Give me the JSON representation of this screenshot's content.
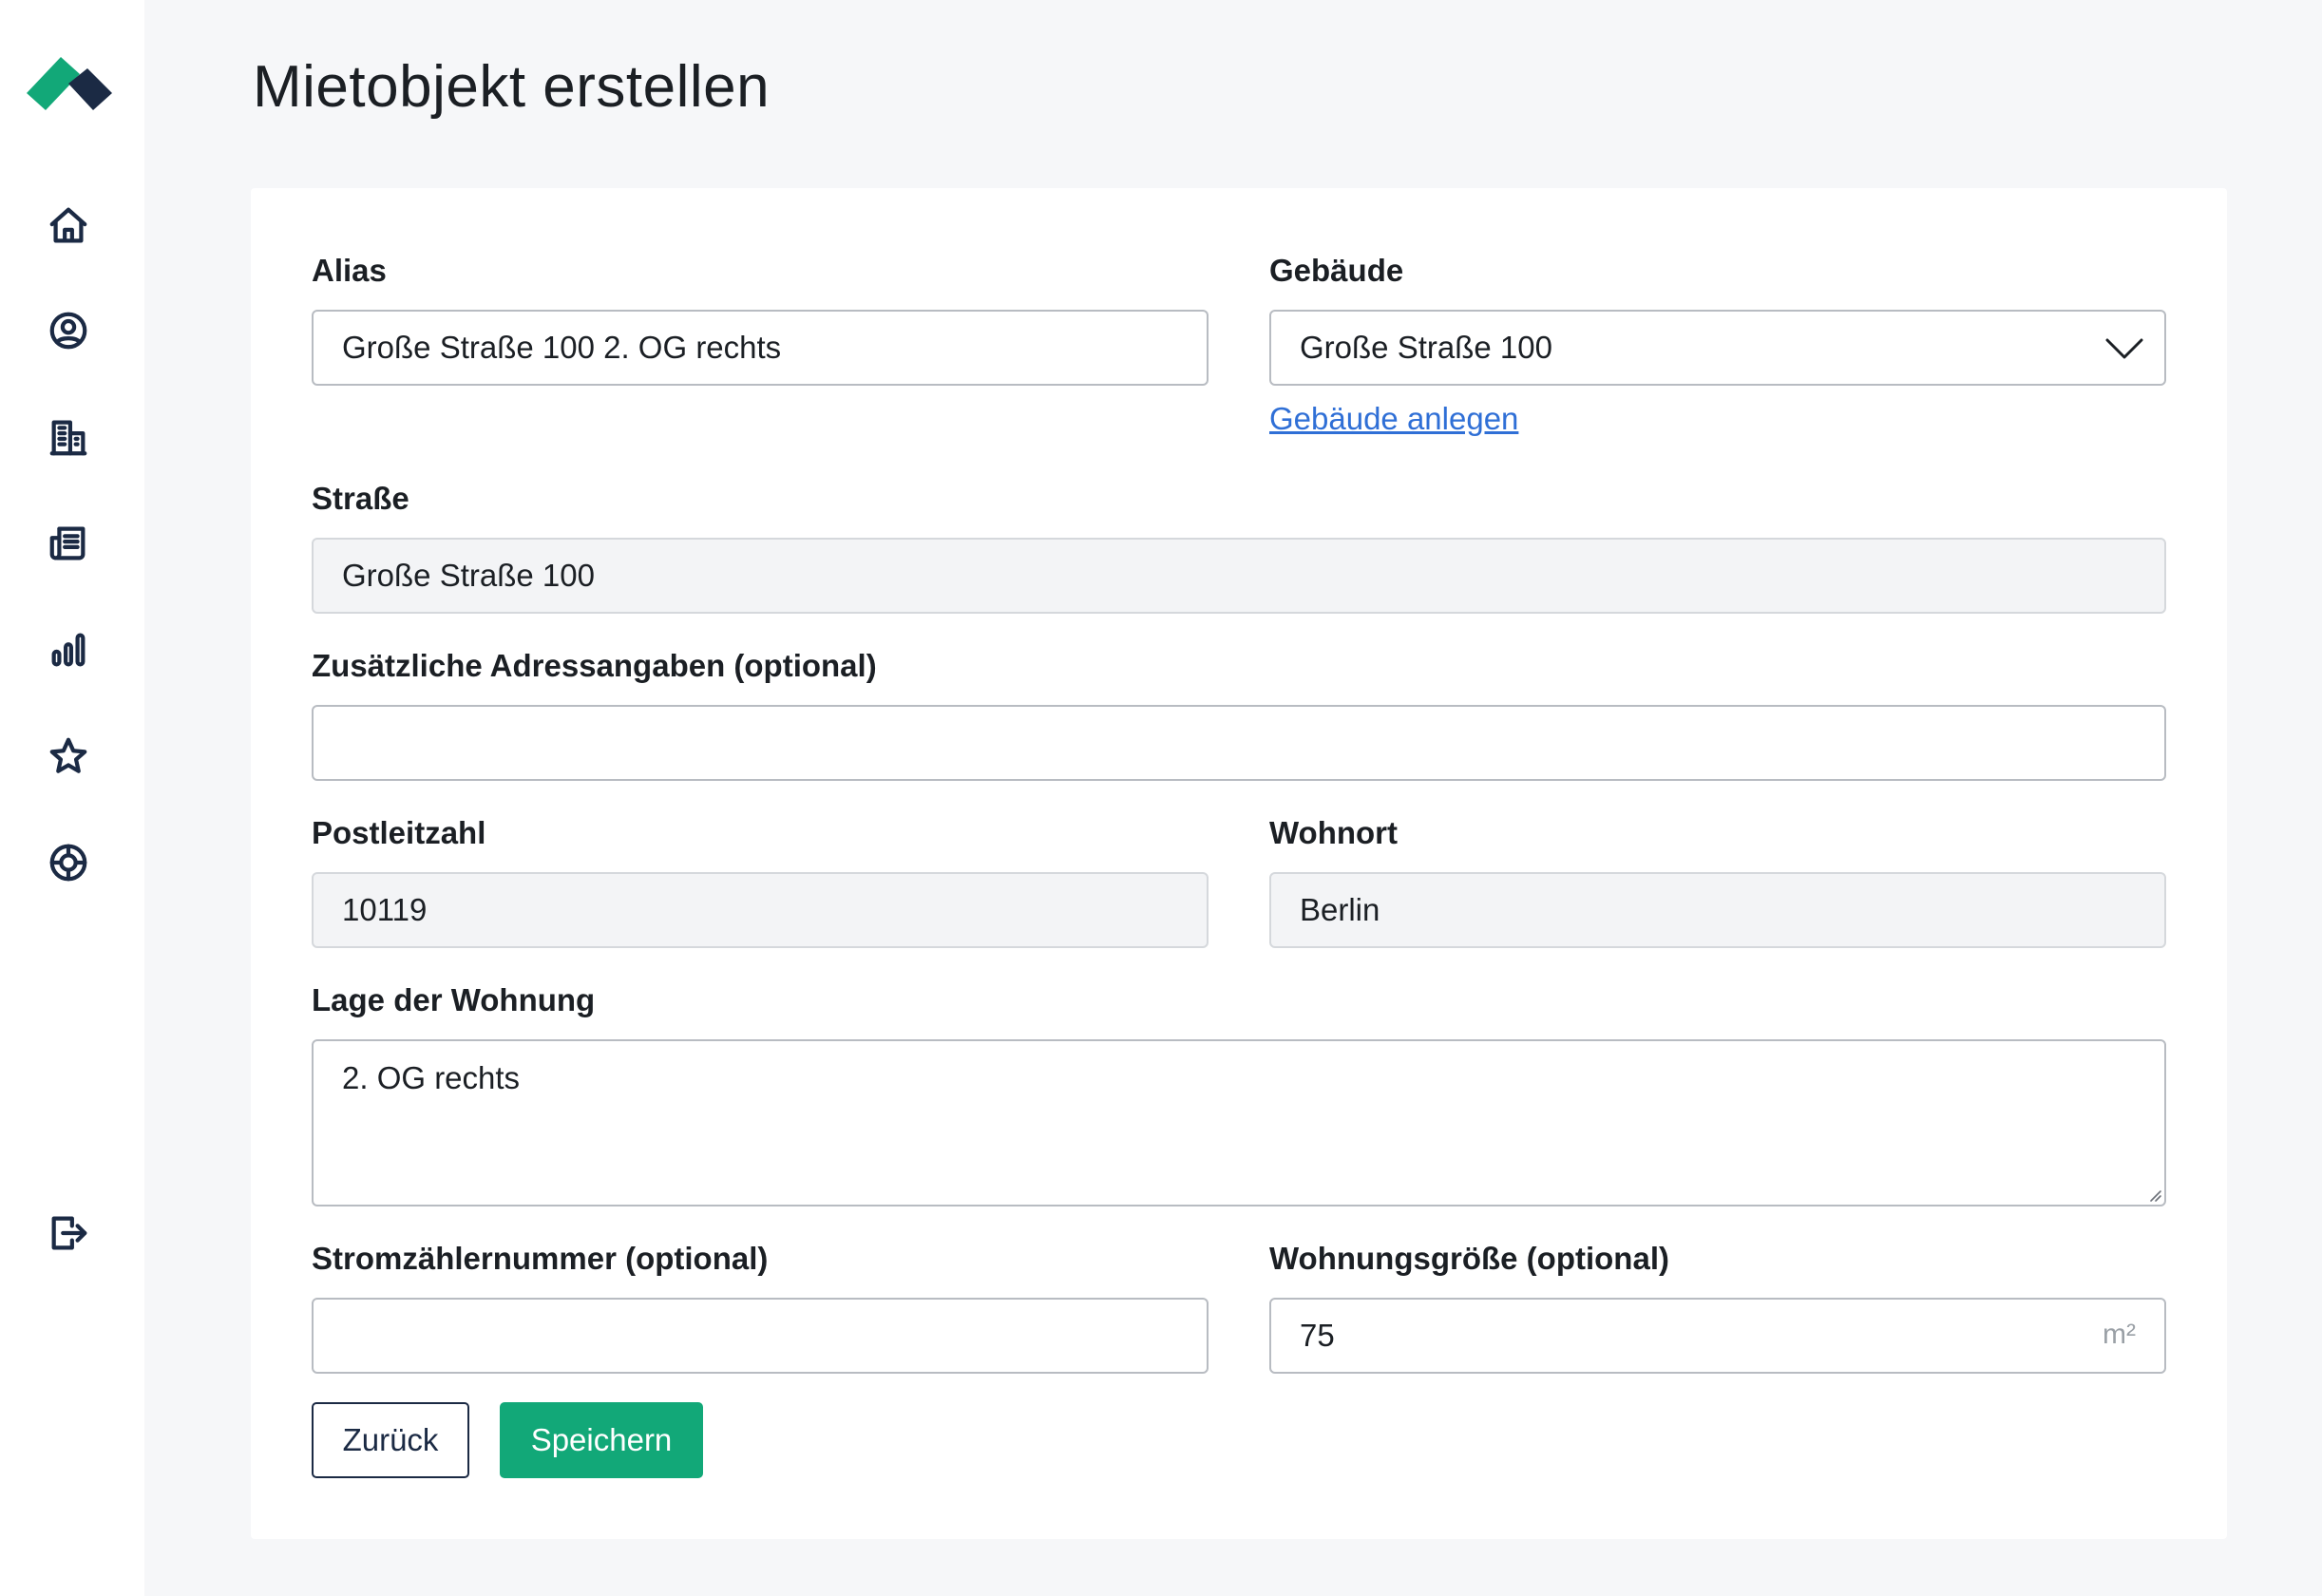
{
  "page": {
    "title": "Mietobjekt erstellen"
  },
  "sidebar": {
    "items": [
      {
        "icon": "home-icon"
      },
      {
        "icon": "user-circle-icon"
      },
      {
        "icon": "building-icon"
      },
      {
        "icon": "newspaper-icon"
      },
      {
        "icon": "bar-chart-icon"
      },
      {
        "icon": "star-icon"
      },
      {
        "icon": "lifebuoy-icon"
      }
    ],
    "logout_icon": "logout-icon"
  },
  "form": {
    "alias": {
      "label": "Alias",
      "value": "Große Straße 100 2. OG rechts"
    },
    "gebaeude": {
      "label": "Gebäude",
      "value": "Große Straße 100",
      "link": "Gebäude anlegen"
    },
    "strasse": {
      "label": "Straße",
      "value": "Große Straße 100"
    },
    "zusatz": {
      "label": "Zusätzliche Adressangaben (optional)",
      "value": ""
    },
    "plz": {
      "label": "Postleitzahl",
      "value": "10119"
    },
    "wohnort": {
      "label": "Wohnort",
      "value": "Berlin"
    },
    "lage": {
      "label": "Lage der Wohnung",
      "value": "2. OG rechts"
    },
    "strom": {
      "label": "Stromzählernummer (optional)",
      "value": ""
    },
    "groesse": {
      "label": "Wohnungsgröße (optional)",
      "value": "75",
      "unit": "m²"
    }
  },
  "buttons": {
    "back": "Zurück",
    "save": "Speichern"
  },
  "colors": {
    "accent": "#12a878",
    "navy": "#1b2a44",
    "link": "#2f6fd6"
  }
}
